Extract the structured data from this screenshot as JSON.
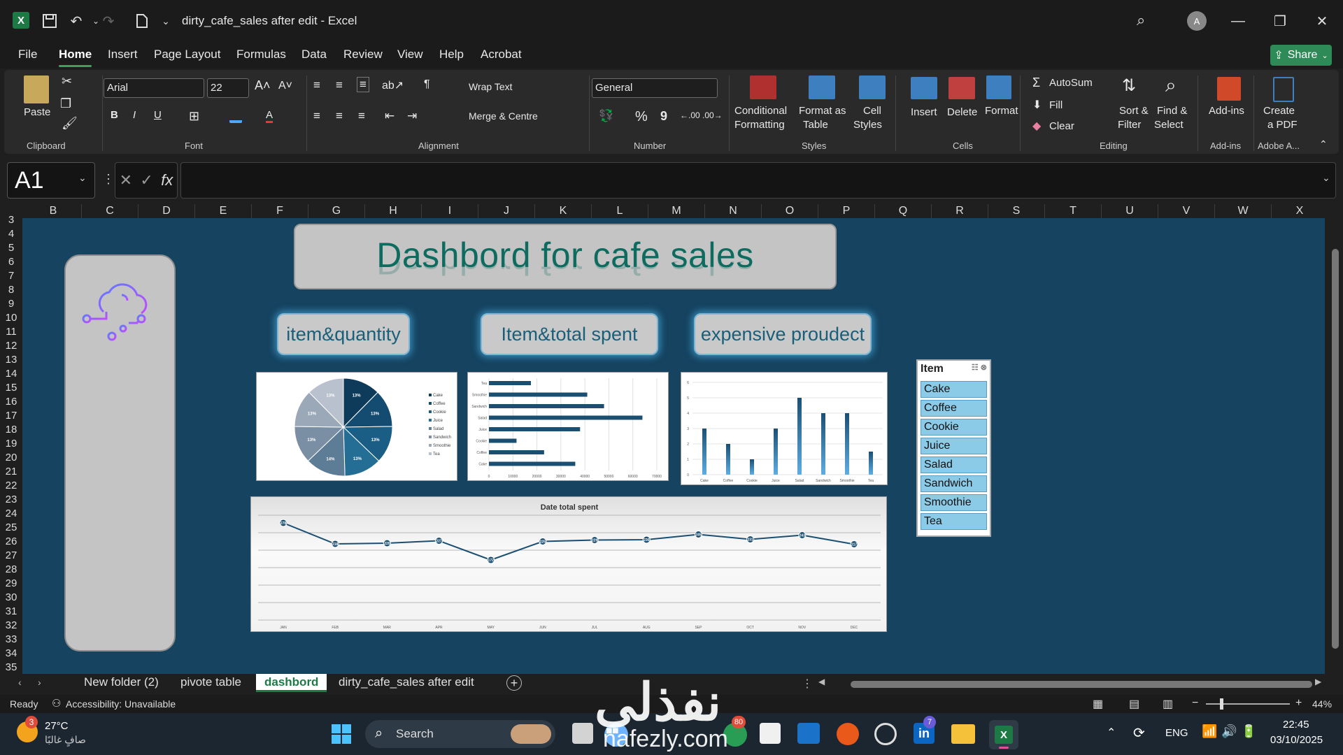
{
  "window": {
    "title": "dirty_cafe_sales after edit  -  Excel",
    "app_icon": "excel-icon",
    "avatar_letter": "A"
  },
  "menu": {
    "tabs": [
      "File",
      "Home",
      "Insert",
      "Page Layout",
      "Formulas",
      "Data",
      "Review",
      "View",
      "Help",
      "Acrobat"
    ],
    "active": "Home",
    "share_label": "Share"
  },
  "ribbon": {
    "clipboard": {
      "paste": "Paste",
      "group": "Clipboard"
    },
    "font": {
      "name": "Arial",
      "size": "22",
      "group": "Font",
      "bold": "B",
      "italic": "I",
      "underline": "U"
    },
    "alignment": {
      "wrap": "Wrap Text",
      "merge": "Merge & Centre",
      "group": "Alignment"
    },
    "number": {
      "format": "General",
      "group": "Number",
      "percent": "%",
      "comma": "9"
    },
    "styles": {
      "conditional": "Conditional",
      "conditional2": "Formatting",
      "format_table": "Format as",
      "format_table2": "Table",
      "cell_styles": "Cell",
      "cell_styles2": "Styles",
      "group": "Styles"
    },
    "cells": {
      "insert": "Insert",
      "delete": "Delete",
      "format": "Format",
      "group": "Cells"
    },
    "editing": {
      "autosum": "AutoSum",
      "fill": "Fill",
      "clear": "Clear",
      "sort": "Sort &",
      "sort2": "Filter",
      "find": "Find &",
      "find2": "Select",
      "group": "Editing"
    },
    "addins": {
      "label": "Add-ins",
      "group": "Add-ins"
    },
    "adobe": {
      "label": "Create",
      "label2": "a PDF",
      "group": "Adobe A..."
    }
  },
  "formula_bar": {
    "name_box": "A1",
    "fx": "fx",
    "value": ""
  },
  "columns": [
    "B",
    "C",
    "D",
    "E",
    "F",
    "G",
    "H",
    "I",
    "J",
    "K",
    "L",
    "M",
    "N",
    "O",
    "P",
    "Q",
    "R",
    "S",
    "T",
    "U",
    "V",
    "W",
    "X"
  ],
  "rows": [
    "3",
    "4",
    "5",
    "6",
    "7",
    "8",
    "9",
    "10",
    "11",
    "12",
    "13",
    "14",
    "15",
    "16",
    "17",
    "18",
    "19",
    "20",
    "21",
    "22",
    "23",
    "24",
    "25",
    "26",
    "27",
    "28",
    "29",
    "30",
    "31",
    "32",
    "33",
    "34",
    "35"
  ],
  "dashboard": {
    "title": "Dashbord for  cafe sales",
    "buttons": [
      "item&quantity",
      "Item&total spent",
      "expensive proudect"
    ],
    "slicer": {
      "header": "Item",
      "items": [
        "Cake",
        "Coffee",
        "Cookie",
        "Juice",
        "Salad",
        "Sandwich",
        "Smoothie",
        "Tea"
      ]
    }
  },
  "chart_data": [
    {
      "type": "pie",
      "categories": [
        "Cake",
        "Coffee",
        "Cookie",
        "Juice",
        "Salad",
        "Sandwich",
        "Smoothie",
        "Tea"
      ],
      "values": [
        13,
        13,
        13,
        13,
        14,
        13,
        13,
        13
      ],
      "labels": [
        "13%",
        "13%",
        "13%",
        "13%",
        "14%",
        "13%",
        "13%",
        "13%"
      ],
      "legend": "right"
    },
    {
      "type": "bar",
      "orientation": "horizontal",
      "categories": [
        "Tea",
        "Smoothie",
        "Sandwich",
        "Salad",
        "Juice",
        "Cookie",
        "Coffee",
        "Cake"
      ],
      "values": [
        17500,
        41000,
        48000,
        64000,
        38000,
        11500,
        23000,
        36000
      ],
      "ticks": [
        "0",
        "10000",
        "20000",
        "30000",
        "40000",
        "50000",
        "60000",
        "70000"
      ],
      "xlim": [
        0,
        70000
      ]
    },
    {
      "type": "bar",
      "categories": [
        "Cake",
        "Coffee",
        "Cookie",
        "Juice",
        "Salad",
        "Sandwich",
        "Smoothie",
        "Tea"
      ],
      "values": [
        3,
        2,
        1,
        3,
        5,
        4,
        4,
        1.5
      ],
      "ticks": [
        "0",
        "1",
        "2",
        "3",
        "4",
        "5",
        "6"
      ],
      "ylim": [
        0,
        6
      ]
    },
    {
      "type": "line",
      "title": "Date total spent",
      "categories": [
        "JAN",
        "FEB",
        "MAR",
        "APR",
        "MAY",
        "JUN",
        "JUL",
        "AUG",
        "SEP",
        "OCT",
        "NOV",
        "DEC"
      ],
      "values": [
        278,
        218,
        220,
        227,
        172,
        225,
        229,
        230,
        245,
        231,
        243,
        217
      ],
      "ylim": [
        0,
        300
      ]
    }
  ],
  "sheet_tabs": {
    "tabs": [
      "New folder (2)",
      "pivote table",
      "dashbord",
      "dirty_cafe_sales after edit"
    ],
    "active": "dashbord"
  },
  "status": {
    "ready": "Ready",
    "accessibility": "Accessibility: Unavailable",
    "zoom": "44%"
  },
  "taskbar": {
    "weather_temp": "27°C",
    "weather_desc": "صافٍ غالبًا",
    "search": "Search",
    "lang": "ENG",
    "time": "22:45",
    "date": "03/10/2025",
    "badges": [
      "3",
      "80",
      "7"
    ],
    "watermark": "نفذلي",
    "watermark_url": "nafezly.com"
  }
}
